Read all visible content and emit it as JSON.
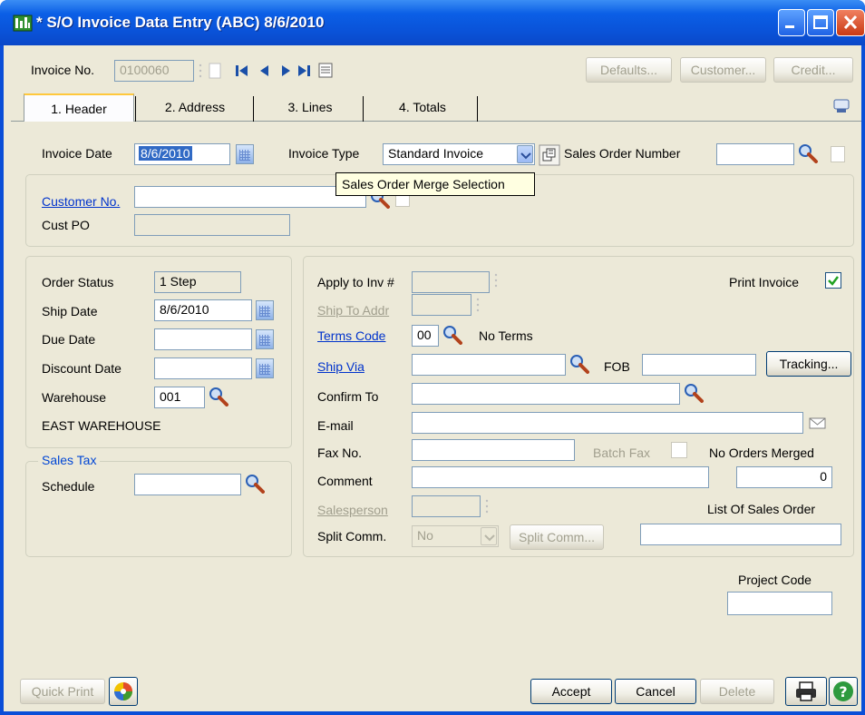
{
  "window": {
    "title": "* S/O Invoice Data Entry (ABC) 8/6/2010"
  },
  "toolbar": {
    "invoice_no_label": "Invoice No.",
    "invoice_no_value": "0100060",
    "defaults_label": "Defaults...",
    "customer_label": "Customer...",
    "credit_label": "Credit..."
  },
  "tabs": [
    {
      "label": "1. Header",
      "active": true
    },
    {
      "label": "2. Address",
      "active": false
    },
    {
      "label": "3. Lines",
      "active": false
    },
    {
      "label": "4. Totals",
      "active": false
    }
  ],
  "header": {
    "invoice_date_label": "Invoice Date",
    "invoice_date_value": "8/6/2010",
    "invoice_type_label": "Invoice Type",
    "invoice_type_value": "Standard Invoice",
    "sales_order_number_label": "Sales Order Number",
    "sales_order_number_value": "",
    "tooltip": "Sales Order Merge Selection",
    "customer_no_label": "Customer No.",
    "customer_no_value": "",
    "cust_po_label": "Cust PO",
    "cust_po_value": ""
  },
  "left": {
    "order_status_label": "Order Status",
    "order_status_value": "1 Step",
    "ship_date_label": "Ship Date",
    "ship_date_value": "8/6/2010",
    "due_date_label": "Due Date",
    "due_date_value": "",
    "discount_date_label": "Discount Date",
    "discount_date_value": "",
    "warehouse_label": "Warehouse",
    "warehouse_value": "001",
    "warehouse_name": "EAST WAREHOUSE",
    "sales_tax_group": "Sales Tax",
    "schedule_label": "Schedule",
    "schedule_value": ""
  },
  "right": {
    "apply_to_inv_label": "Apply to Inv #",
    "apply_to_inv_value": "",
    "print_invoice_label": "Print Invoice",
    "print_invoice_checked": true,
    "ship_to_addr_label": "Ship To Addr",
    "ship_to_addr_value": "",
    "terms_code_label": "Terms Code",
    "terms_code_value": "00",
    "terms_desc": "No Terms",
    "ship_via_label": "Ship Via",
    "ship_via_value": "",
    "fob_label": "FOB",
    "fob_value": "",
    "tracking_label": "Tracking...",
    "confirm_to_label": "Confirm To",
    "confirm_to_value": "",
    "email_label": "E-mail",
    "email_value": "",
    "fax_no_label": "Fax No.",
    "fax_no_value": "",
    "batch_fax_label": "Batch Fax",
    "no_orders_merged_label": "No Orders Merged",
    "no_orders_merged_value": "0",
    "comment_label": "Comment",
    "comment_value": "",
    "salesperson_label": "Salesperson",
    "salesperson_value": "",
    "list_of_sales_order_label": "List Of Sales Order",
    "list_of_sales_order_value": "",
    "split_comm_label": "Split Comm.",
    "split_comm_value": "No",
    "split_comm_button": "Split Comm..."
  },
  "project": {
    "project_code_label": "Project Code",
    "project_code_value": ""
  },
  "footer": {
    "quick_print_label": "Quick Print",
    "accept_label": "Accept",
    "cancel_label": "Cancel",
    "delete_label": "Delete"
  },
  "colors": {
    "titlebar": "#0a52d8",
    "client_bg": "#ece9d8",
    "link": "#0033cc",
    "disabled_text": "#a19f8e"
  }
}
